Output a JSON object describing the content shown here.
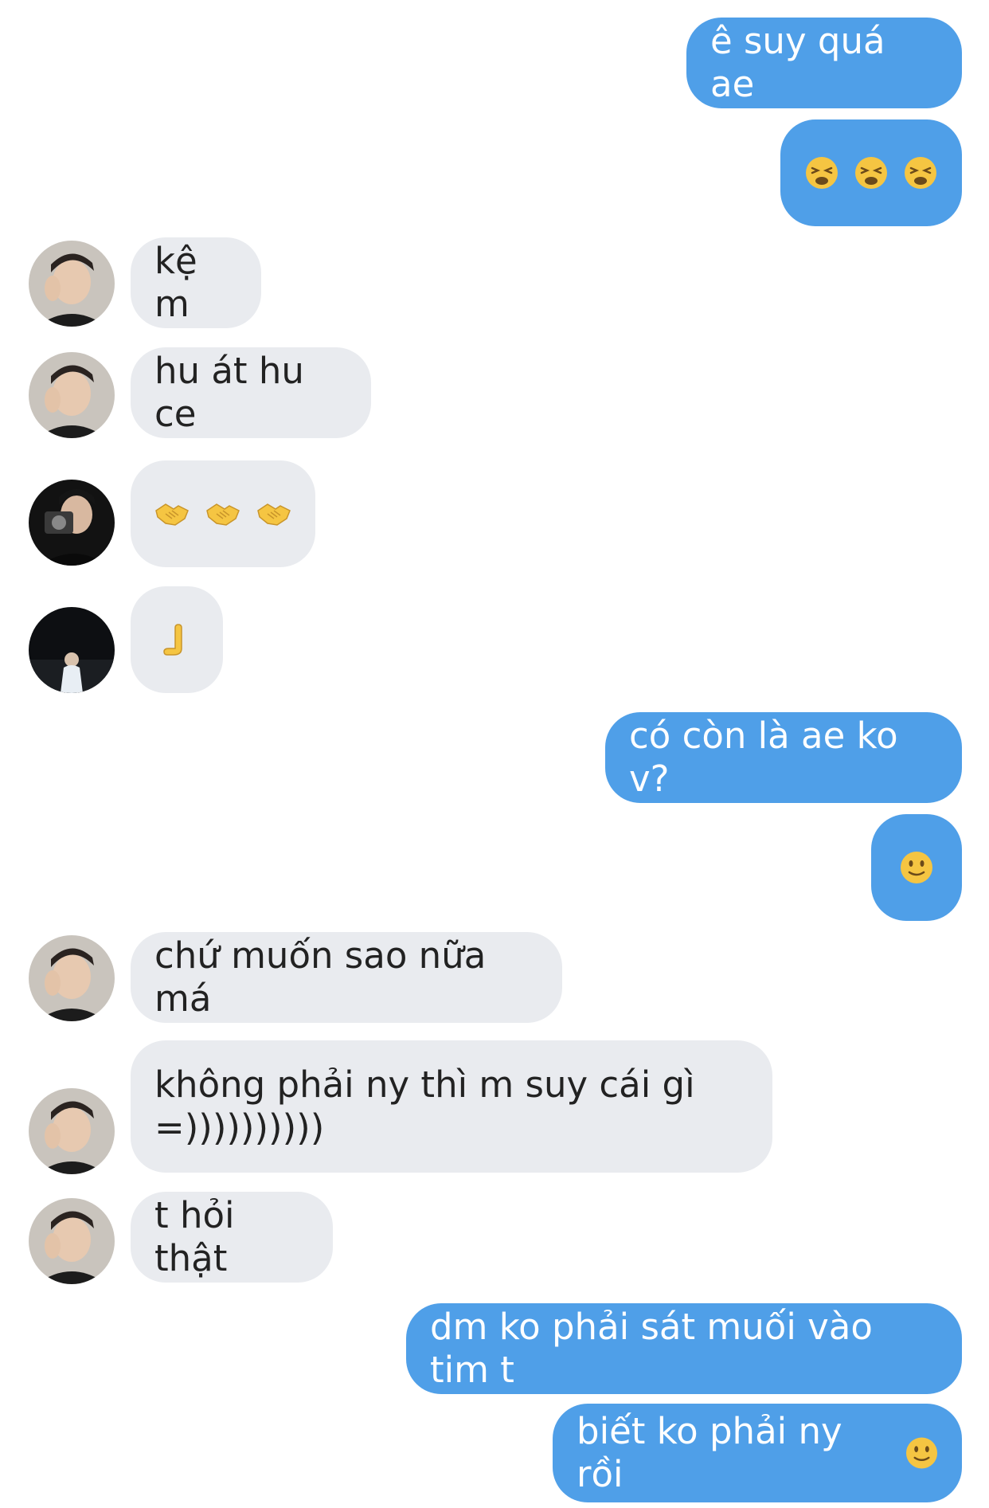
{
  "messages": [
    {
      "side": "out",
      "text": "ê suy quá ae"
    },
    {
      "side": "out",
      "emoji": [
        "weary-face",
        "weary-face",
        "weary-face"
      ]
    },
    {
      "side": "in",
      "avatar": "person-a",
      "text": "kệ m"
    },
    {
      "side": "in",
      "avatar": "person-a",
      "text": "hu át hu ce"
    },
    {
      "side": "in",
      "avatar": "person-b",
      "emoji": [
        "handshake",
        "handshake",
        "handshake"
      ]
    },
    {
      "side": "in",
      "avatar": "person-c",
      "emoji": [
        "raised-back-of-hand"
      ]
    },
    {
      "side": "out",
      "text": "có còn là ae ko v?"
    },
    {
      "side": "out",
      "emoji": [
        "slightly-smiling-face"
      ]
    },
    {
      "side": "in",
      "avatar": "person-a",
      "text": "chứ muốn sao nữa má"
    },
    {
      "side": "in",
      "avatar": "person-a",
      "text": "không phải ny thì m suy cái gì\n=))))))))))"
    },
    {
      "side": "in",
      "avatar": "person-a",
      "text": "t hỏi thật"
    },
    {
      "side": "out",
      "text": "dm ko phải sát muối vào tim t"
    },
    {
      "side": "out",
      "text": "biết ko phải ny rồi",
      "emoji": [
        "slightly-smiling-face"
      ]
    }
  ],
  "colors": {
    "outgoing_bubble": "#4f9fe8",
    "incoming_bubble": "#e9ebef",
    "outgoing_text": "#ffffff",
    "incoming_text": "#222222",
    "emoji_yellow": "#f5c542"
  }
}
